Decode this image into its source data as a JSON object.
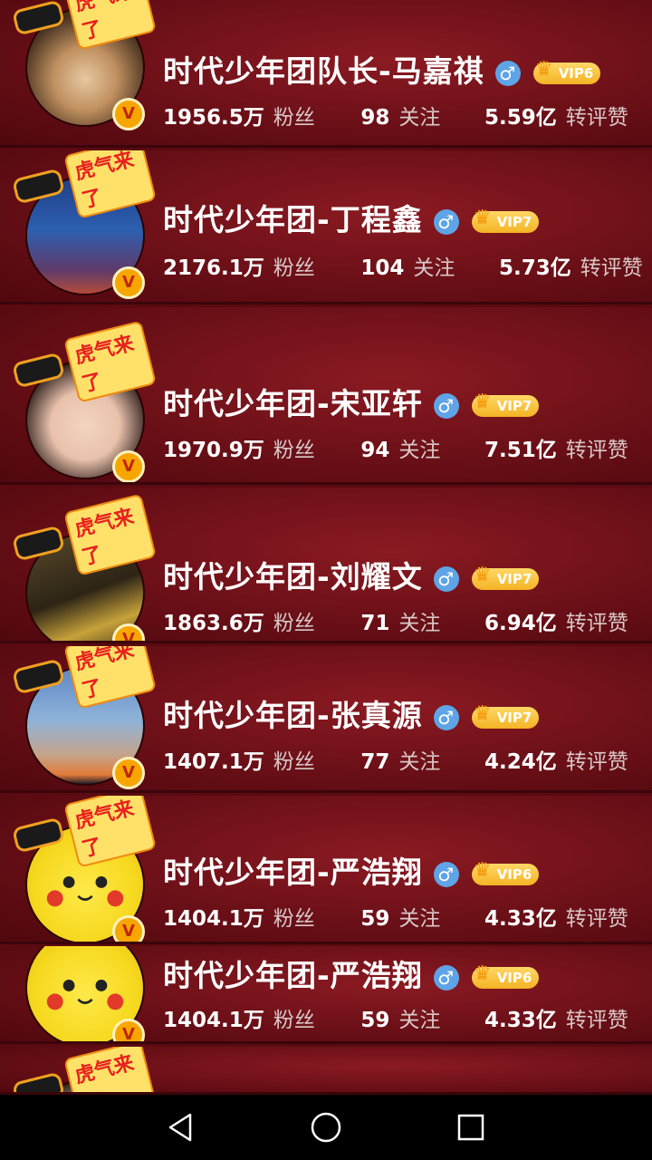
{
  "tiger_sticker_text": "虎气来了",
  "verified_mark": "V",
  "gender_symbol": "♂",
  "labels": {
    "fans": "粉丝",
    "following": "关注",
    "likes": "转评赞"
  },
  "users": [
    {
      "name": "时代少年团队长-马嘉祺",
      "vip": "VIP6",
      "fans": "1956.5万",
      "following": "98",
      "likes": "5.59亿"
    },
    {
      "name": "时代少年团-丁程鑫",
      "vip": "VIP7",
      "fans": "2176.1万",
      "following": "104",
      "likes": "5.73亿"
    },
    {
      "name": "时代少年团-宋亚轩",
      "vip": "VIP7",
      "fans": "1970.9万",
      "following": "94",
      "likes": "7.51亿"
    },
    {
      "name": "时代少年团-刘耀文",
      "vip": "VIP7",
      "fans": "1863.6万",
      "following": "71",
      "likes": "6.94亿"
    },
    {
      "name": "时代少年团-张真源",
      "vip": "VIP7",
      "fans": "1407.1万",
      "following": "77",
      "likes": "4.24亿"
    },
    {
      "name": "时代少年团-严浩翔",
      "vip": "VIP6",
      "fans": "1404.1万",
      "following": "59",
      "likes": "4.33亿"
    },
    {
      "name": "时代少年团-严浩翔",
      "vip": "VIP6",
      "fans": "1404.1万",
      "following": "59",
      "likes": "4.33亿"
    }
  ],
  "colors": {
    "background": "#6a0f17",
    "vip_gold": "#f4b324",
    "gender_blue": "#5ea4e6",
    "verified_orange": "#f7a600"
  },
  "nav": {
    "back_icon": "back-triangle-icon",
    "home_icon": "home-circle-icon",
    "recent_icon": "recent-square-icon"
  }
}
